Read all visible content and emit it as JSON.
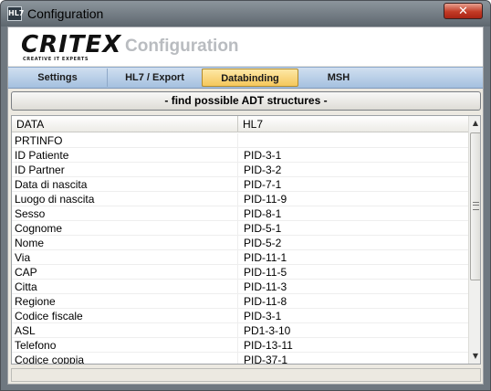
{
  "window": {
    "title": "Configuration",
    "app_icon": "HL7",
    "close_glyph": "✕"
  },
  "header": {
    "logo_text": "CRITEX",
    "logo_tagline": "CREATIVE IT EXPERTS",
    "title": "Configuration"
  },
  "tabs": [
    {
      "label": "Settings",
      "active": false
    },
    {
      "label": "HL7 / Export",
      "active": false
    },
    {
      "label": "Databinding",
      "active": true
    },
    {
      "label": "MSH",
      "active": false
    }
  ],
  "find_button": {
    "label": "- find possible ADT structures -"
  },
  "grid": {
    "columns": [
      "DATA",
      "HL7"
    ],
    "rows": [
      [
        "PRTINFO",
        ""
      ],
      [
        "ID Patiente",
        "PID-3-1"
      ],
      [
        "ID Partner",
        "PID-3-2"
      ],
      [
        "Data di nascita",
        "PID-7-1"
      ],
      [
        "Luogo di nascita",
        "PID-11-9"
      ],
      [
        "Sesso",
        "PID-8-1"
      ],
      [
        "Cognome",
        "PID-5-1"
      ],
      [
        "Nome",
        "PID-5-2"
      ],
      [
        "Via",
        "PID-11-1"
      ],
      [
        "CAP",
        "PID-11-5"
      ],
      [
        "Citta",
        "PID-11-3"
      ],
      [
        "Regione",
        "PID-11-8"
      ],
      [
        "Codice fiscale",
        "PID-3-1"
      ],
      [
        "ASL",
        "PD1-3-10"
      ],
      [
        "Telefono",
        "PID-13-11"
      ],
      [
        "Codice coppia",
        "PID-37-1"
      ]
    ]
  },
  "scrollbar": {
    "up_glyph": "▲",
    "down_glyph": "▼"
  },
  "colors": {
    "active_tab": "#f5c75c",
    "tab_bar": "#a4c0df",
    "close_button": "#c33b26",
    "title_gray": "#b9bcc0"
  }
}
